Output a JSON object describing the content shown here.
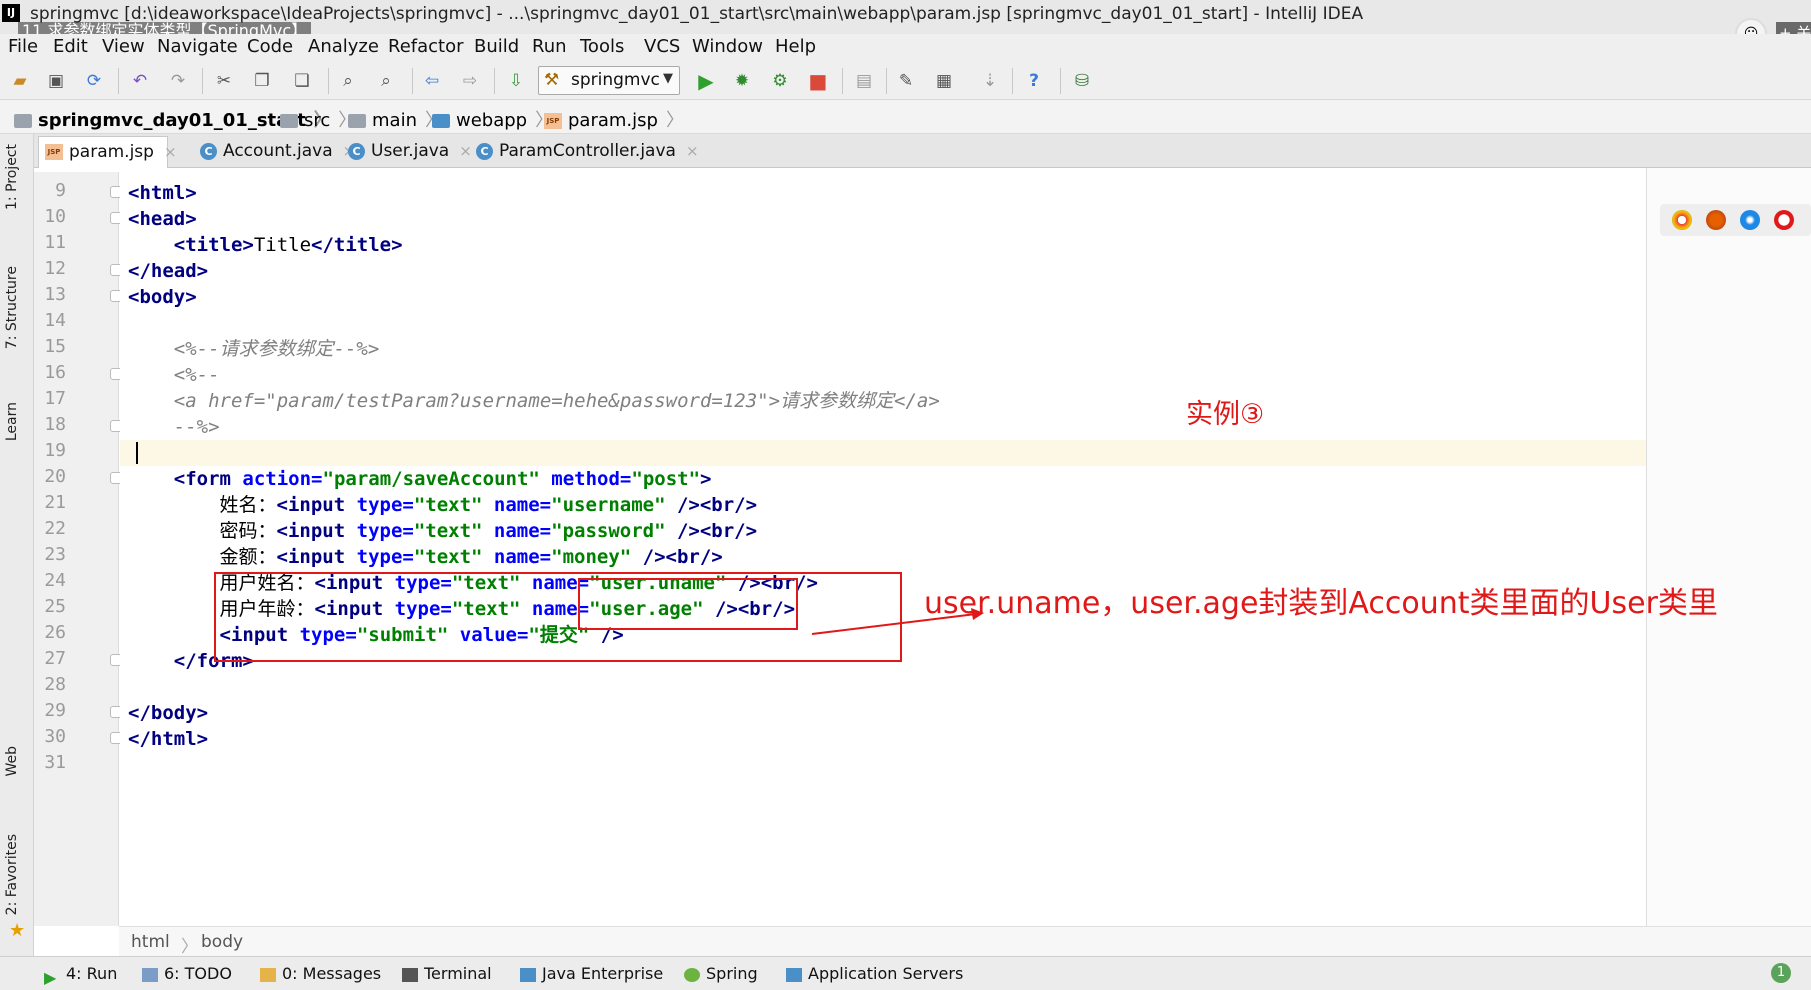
{
  "window": {
    "title": "springmvc [d:\\ideaworkspace\\IdeaProjects\\springmvc] - ...\\springmvc_day01_01_start\\src\\main\\webapp\\param.jsp [springmvc_day01_01_start] - IntelliJ IDEA",
    "video_title": "11.求参数绑定实体类型【SpringMvc】",
    "overlay_plus": "+ 关",
    "app_logo": "IJ"
  },
  "menu": [
    "File",
    "Edit",
    "View",
    "Navigate",
    "Code",
    "Analyze",
    "Refactor",
    "Build",
    "Run",
    "Tools",
    "VCS",
    "Window",
    "Help"
  ],
  "toolbar": {
    "run_config": "springmvc",
    "help_glyph": "?"
  },
  "breadcrumb": [
    "springmvc_day01_01_start",
    "src",
    "main",
    "webapp",
    "param.jsp"
  ],
  "jsp_icon_text": "JSP",
  "class_icon_text": "C",
  "left_tool_tabs": [
    "1: Project",
    "7: Structure",
    "Learn",
    "Web",
    "2: Favorites"
  ],
  "tabs": [
    {
      "label": "param.jsp",
      "icon": "jsp-file-icon",
      "active": true
    },
    {
      "label": "Account.java",
      "icon": "class-icon",
      "active": false
    },
    {
      "label": "User.java",
      "icon": "class-icon",
      "active": false
    },
    {
      "label": "ParamController.java",
      "icon": "class-icon",
      "active": false
    }
  ],
  "editor": {
    "line_numbers": [
      "9",
      "10",
      "11",
      "12",
      "13",
      "14",
      "15",
      "16",
      "17",
      "18",
      "19",
      "20",
      "21",
      "22",
      "23",
      "24",
      "25",
      "26",
      "27",
      "28",
      "29",
      "30",
      "31"
    ],
    "current_line": "19"
  },
  "annotations": {
    "example_label": "实例③",
    "note": "user.uname，user.age封装到Account类里面的User类里"
  },
  "editor_breadcrumb": [
    "html",
    "body"
  ],
  "bottom_tabs": [
    "4: Run",
    "6: TODO",
    "0: Messages",
    "Terminal",
    "Java Enterprise",
    "Spring",
    "Application Servers"
  ],
  "bottom_right_badge": "1",
  "colors": {
    "annotation_red": "#e01818",
    "tag_blue": "#000080",
    "attr_blue": "#0000ff",
    "string_green": "#008000",
    "comment_gray": "#808080",
    "current_line_bg": "#fcf8e5"
  }
}
